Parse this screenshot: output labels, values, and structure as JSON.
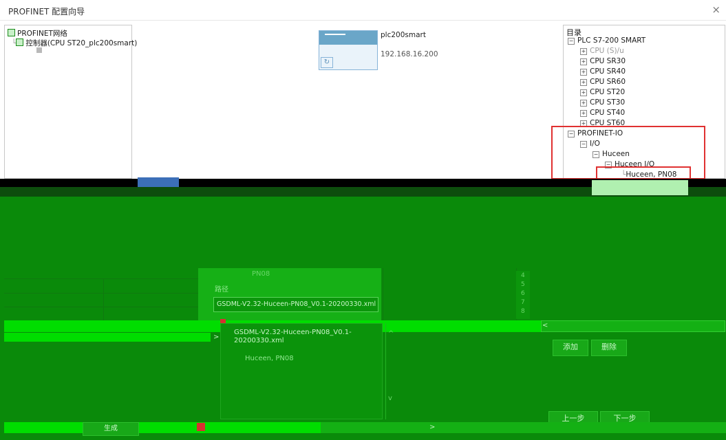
{
  "window": {
    "title": "PROFINET 配置向导",
    "close_glyph": "×"
  },
  "network_tree": {
    "root": "PROFINET网络",
    "controller": "控制器(CPU ST20_plc200smart)"
  },
  "device": {
    "name": "plc200smart",
    "ip": "192.168.16.200",
    "port_glyph": "↻"
  },
  "catalog": {
    "title": "目录",
    "plc_root": "PLC S7-200 SMART",
    "cpus": [
      "CPU (S)/u",
      "CPU SR30",
      "CPU SR40",
      "CPU SR60",
      "CPU ST20",
      "CPU ST30",
      "CPU ST40",
      "CPU ST60"
    ],
    "profinet_io": "PROFINET-IO",
    "io": "I/O",
    "vendor": "Huceen",
    "vendor_io": "Huceen I/O",
    "device": "Huceen, PN08"
  },
  "gsd": {
    "header_partial": "PN08",
    "section_label": "路径",
    "file_input": "GSDML-V2.32-Huceen-PN08_V0.1-20200330.xml",
    "list_item_line1": "GSDML-V2.32-Huceen-PN08_V0.1-",
    "list_item_line2": "20200330.xml",
    "list_item_device": "Huceen, PN08"
  },
  "table_rows": [
    "4",
    "5",
    "6",
    "7",
    "8"
  ],
  "buttons": {
    "add": "添加",
    "delete": "删除",
    "prev": "上一步",
    "next": "下一步",
    "generate": "生成"
  },
  "scroll": {
    "left_arrow": "<",
    "right_arrow": ">",
    "up_arrow": "^",
    "down_arrow": "v"
  },
  "colors": {
    "accent_green": "#0a8a0a",
    "highlight_red": "#e03030",
    "device_fill": "#6aa6c8"
  }
}
